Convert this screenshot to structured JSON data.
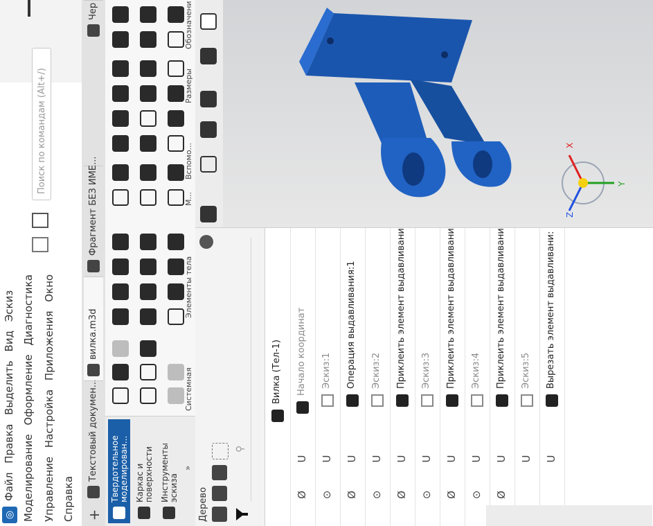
{
  "menu": {
    "rows": [
      [
        "Файл",
        "Правка",
        "Выделить",
        "Вид",
        "Эскиз"
      ],
      [
        "Моделирование",
        "Оформление",
        "Диагностика"
      ],
      [
        "Управление",
        "Настройка",
        "Приложения",
        "Окно"
      ],
      [
        "Справка"
      ]
    ]
  },
  "search": {
    "placeholder": "Поиск по командам (Alt+/)"
  },
  "tabs": [
    {
      "label": "Текстовый докумен...",
      "icon": "text-document-icon",
      "active": false
    },
    {
      "label": "вилка.m3d",
      "icon": "part-3d-icon",
      "active": true
    },
    {
      "label": "Фрагмент БЕЗ ИМЕ...",
      "icon": "fragment-icon",
      "active": false
    },
    {
      "label": "Чер",
      "icon": "drawing-icon",
      "active": false
    }
  ],
  "nav": [
    {
      "label": "Твердотельное моделирован...",
      "active": true
    },
    {
      "label": "Каркас и поверхности",
      "active": false
    },
    {
      "label": "Инструменты эскиза",
      "active": false
    }
  ],
  "ribbon_groups": [
    "Системная",
    "Элементы тела",
    "М...",
    "Вспомо...",
    "Размеры",
    "Обозначени"
  ],
  "panel": {
    "title": "Дерево",
    "search_icon": "search-icon"
  },
  "tree": [
    {
      "label": "Вилка (Тел-1)",
      "kind": "part",
      "muted": false,
      "eye": "",
      "vis": ""
    },
    {
      "label": "Начало координат",
      "kind": "origin",
      "muted": true,
      "eye": "hidden-eye-icon",
      "vis": "U"
    },
    {
      "label": "Эскиз:1",
      "kind": "sketch",
      "muted": true,
      "eye": "visible-eye-icon",
      "vis": "U"
    },
    {
      "label": "Операция выдавливания:1",
      "kind": "feature",
      "muted": false,
      "eye": "hidden-eye-icon",
      "vis": "U"
    },
    {
      "label": "Эскиз:2",
      "kind": "sketch",
      "muted": true,
      "eye": "visible-eye-icon",
      "vis": "U"
    },
    {
      "label": "Приклеить элемент выдавливани",
      "kind": "feature",
      "muted": false,
      "eye": "hidden-eye-icon",
      "vis": "U"
    },
    {
      "label": "Эскиз:3",
      "kind": "sketch",
      "muted": true,
      "eye": "visible-eye-icon",
      "vis": "U"
    },
    {
      "label": "Приклеить элемент выдавливани",
      "kind": "feature",
      "muted": false,
      "eye": "hidden-eye-icon",
      "vis": "U"
    },
    {
      "label": "Эскиз:4",
      "kind": "sketch",
      "muted": true,
      "eye": "visible-eye-icon",
      "vis": "U"
    },
    {
      "label": "Приклеить элемент выдавливани",
      "kind": "feature",
      "muted": false,
      "eye": "hidden-eye-icon",
      "vis": "U"
    },
    {
      "label": "Эскиз:5",
      "kind": "sketch",
      "muted": true,
      "eye": "",
      "vis": "U"
    },
    {
      "label": "Вырезать элемент выдавливани:",
      "kind": "feature",
      "muted": false,
      "eye": "",
      "vis": "U"
    }
  ],
  "axes": {
    "x": "X",
    "y": "Y",
    "z": "Z"
  },
  "colors": {
    "part": "#1f5fb8",
    "accent": "#1b5fa8"
  }
}
